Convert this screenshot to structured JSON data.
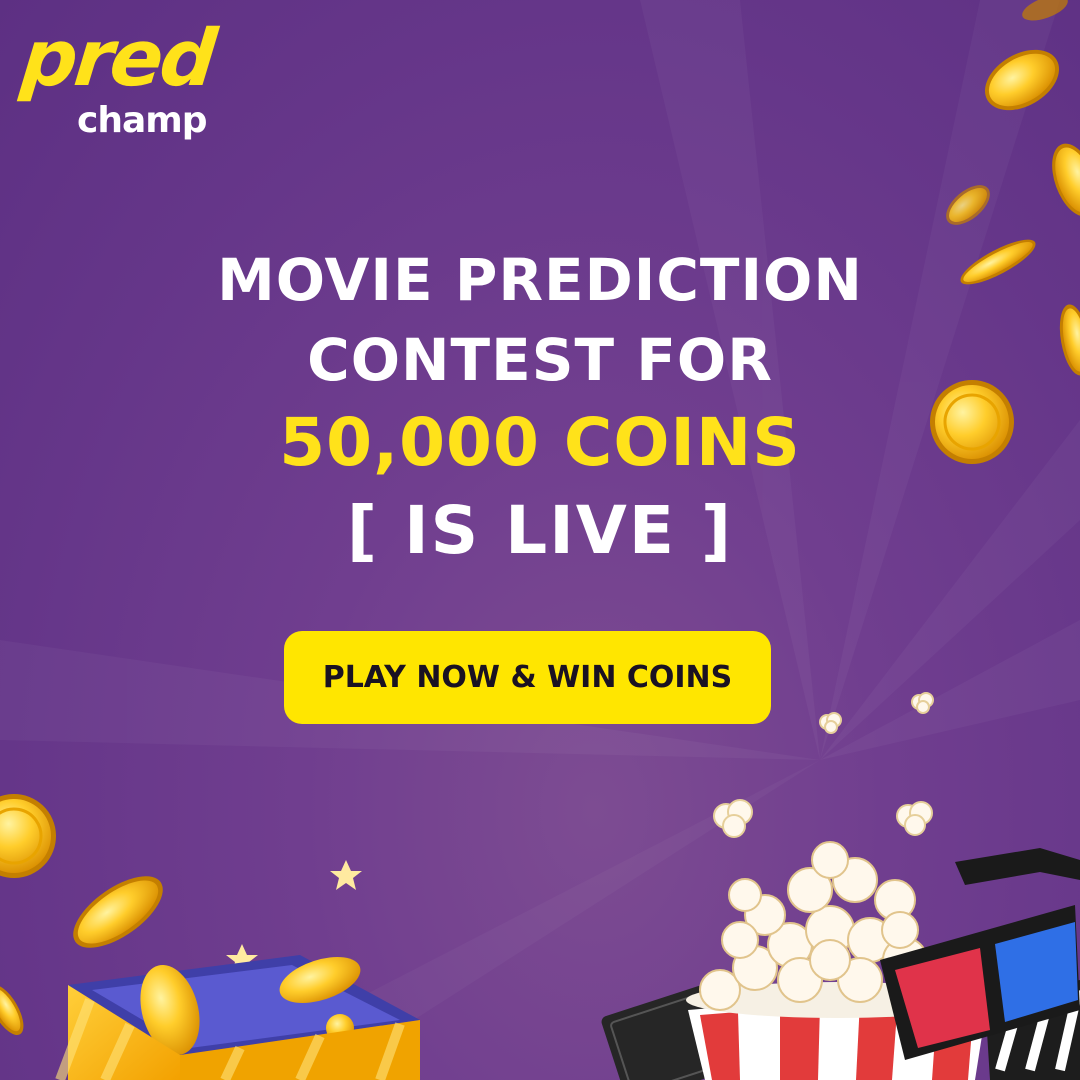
{
  "brand": {
    "line1": "pred",
    "line2": "champ"
  },
  "headline": {
    "line1": "MOVIE PREDICTION",
    "line2": "CONTEST FOR",
    "line3": "50,000 COINS",
    "line4": "[ IS LIVE ]"
  },
  "cta": {
    "label": "PLAY NOW & WIN COINS"
  },
  "colors": {
    "background": "#6a3a8c",
    "accent": "#ffe21a",
    "text": "#ffffff",
    "button_text": "#1a1222"
  },
  "icons": [
    "coin-icon",
    "gift-box-icon",
    "star-icon",
    "popcorn-bucket-icon",
    "3d-glasses-icon",
    "cinema-ticket-icon",
    "clapperboard-icon"
  ]
}
